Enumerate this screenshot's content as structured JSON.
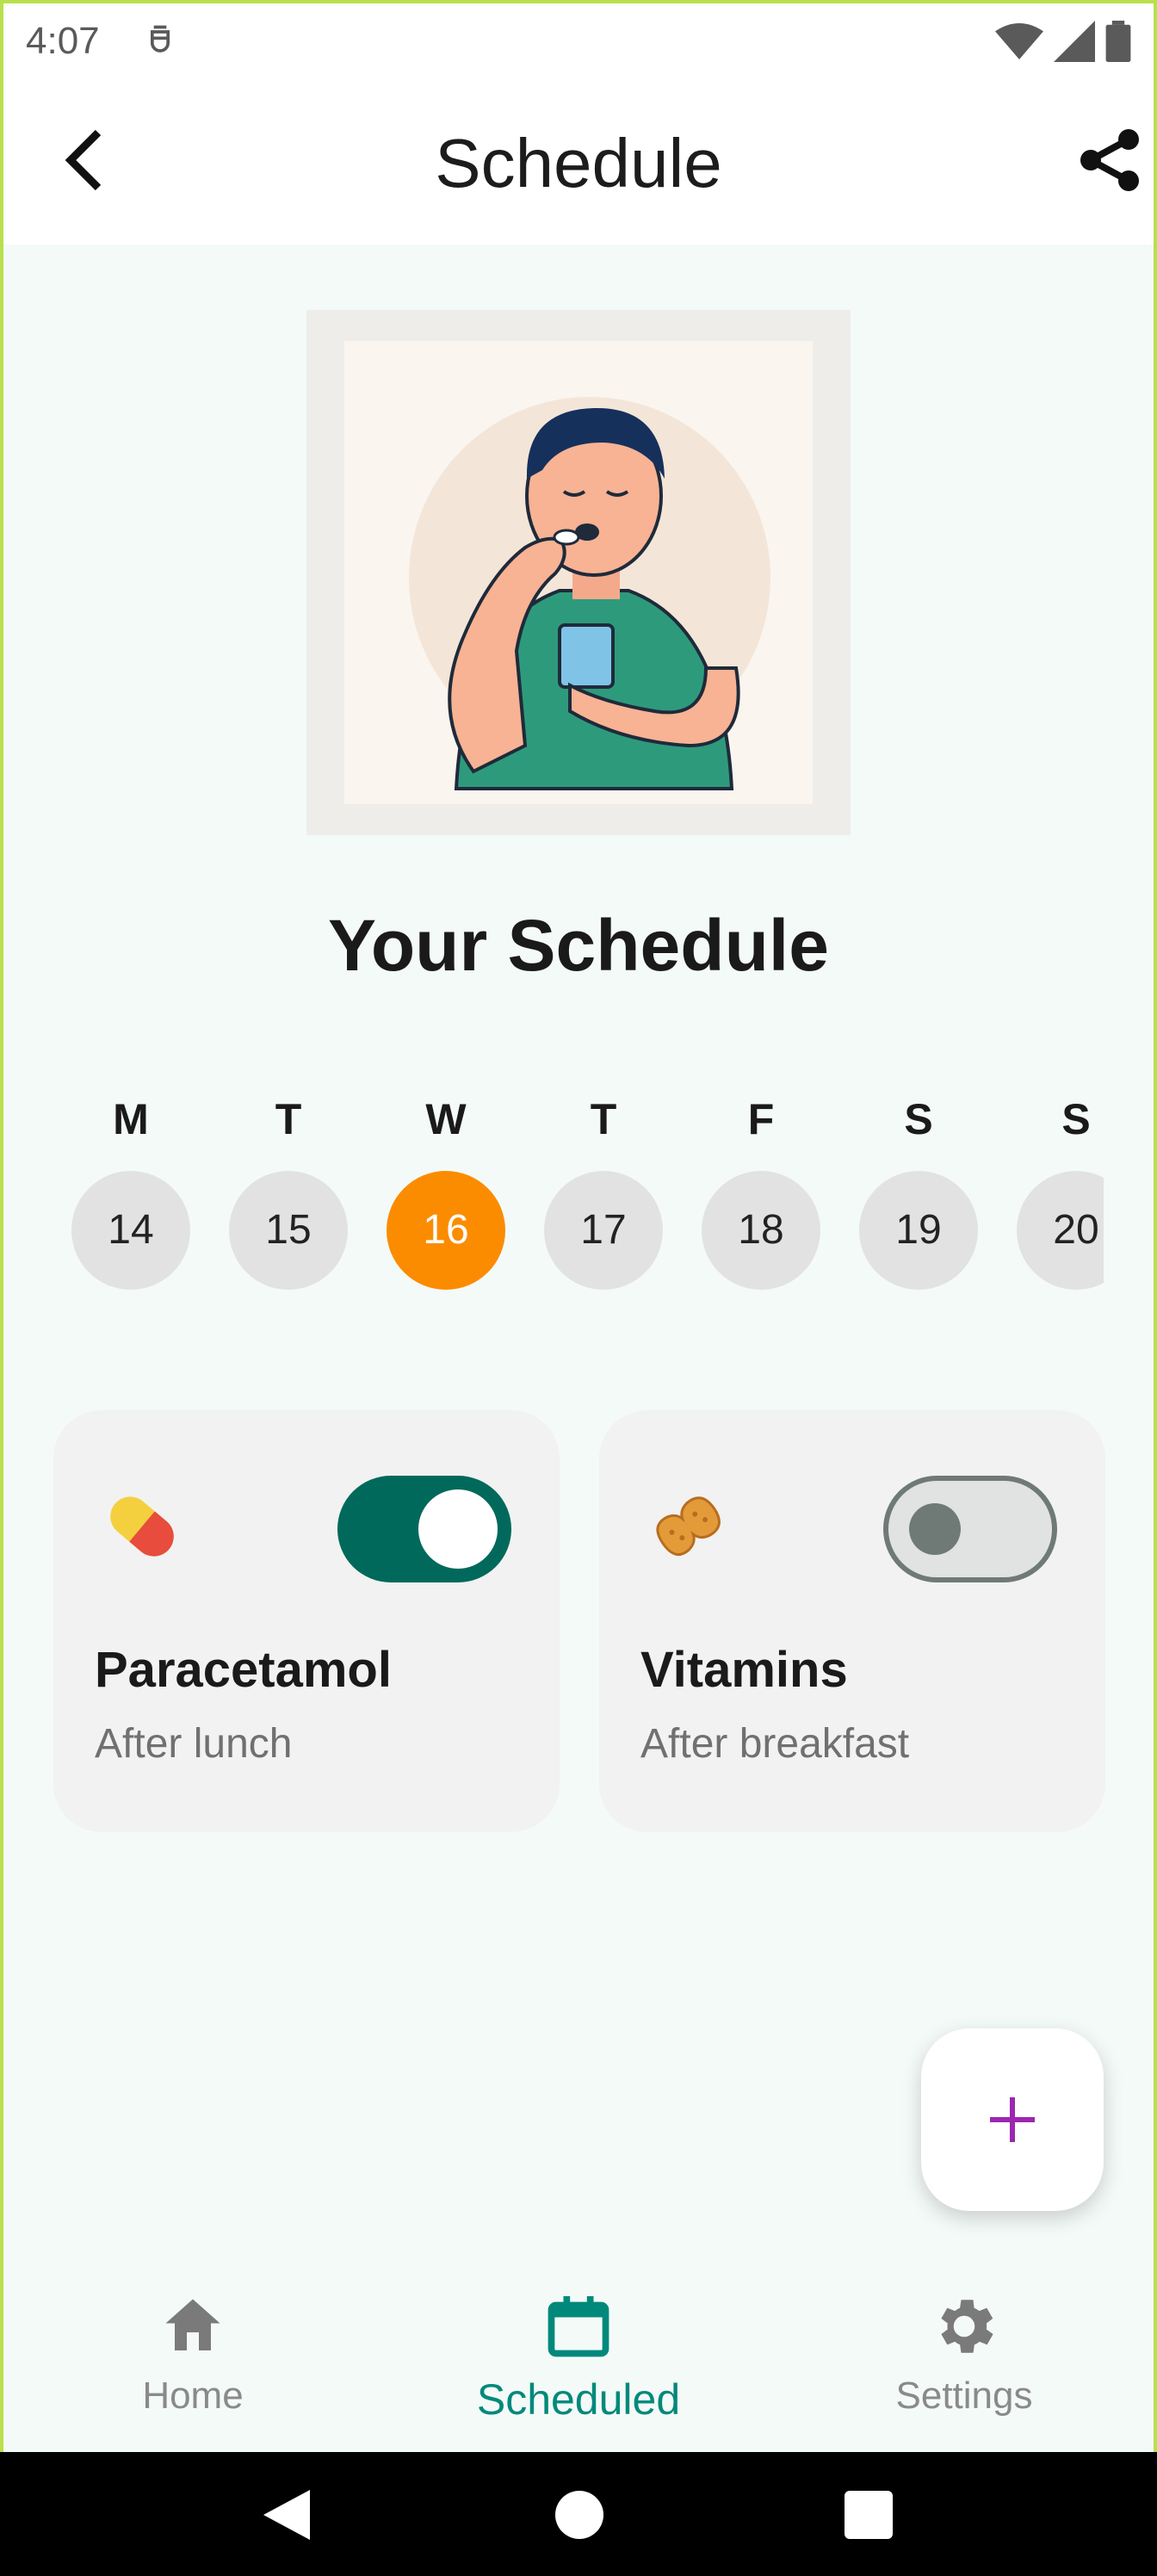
{
  "status_bar": {
    "time": "4:07"
  },
  "app_bar": {
    "title": "Schedule"
  },
  "main": {
    "section_title": "Your Schedule",
    "week": [
      {
        "letter": "M",
        "date": "14",
        "active": false
      },
      {
        "letter": "T",
        "date": "15",
        "active": false
      },
      {
        "letter": "W",
        "date": "16",
        "active": true
      },
      {
        "letter": "T",
        "date": "17",
        "active": false
      },
      {
        "letter": "F",
        "date": "18",
        "active": false
      },
      {
        "letter": "S",
        "date": "19",
        "active": false
      },
      {
        "letter": "S",
        "date": "20",
        "active": false
      }
    ],
    "cards": [
      {
        "name": "Paracetamol",
        "subtitle": "After lunch",
        "icon": "pill-icon",
        "enabled": true
      },
      {
        "name": "Vitamins",
        "subtitle": "After breakfast",
        "icon": "peanut-icon",
        "enabled": false
      }
    ]
  },
  "bottom_nav": {
    "items": [
      {
        "label": "Home",
        "icon": "home-icon",
        "active": false
      },
      {
        "label": "Scheduled",
        "icon": "calendar-icon",
        "active": true
      },
      {
        "label": "Settings",
        "icon": "gear-icon",
        "active": false
      }
    ]
  },
  "colors": {
    "primary": "#00695c",
    "active_day": "#fb8c00",
    "nav_active": "#00897b",
    "fab_icon": "#9c27b0"
  }
}
